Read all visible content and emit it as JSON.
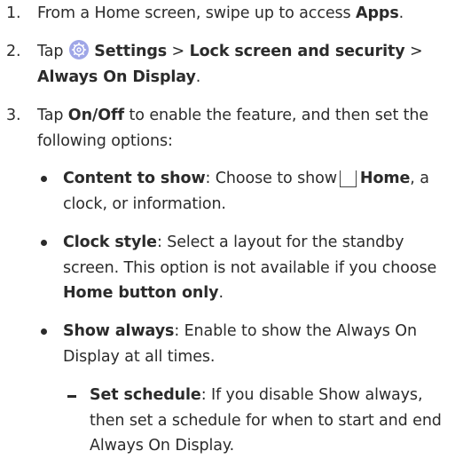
{
  "steps": [
    {
      "num": "1.",
      "prefix": "From a Home screen, swipe up to access ",
      "apps": "Apps",
      "suffix": "."
    },
    {
      "num": "2.",
      "tap": "Tap ",
      "settings": "Settings",
      "sep1": " > ",
      "lock_screen": "Lock screen and security",
      "sep2": " >",
      "always_on": "Always On Display",
      "end": "."
    },
    {
      "num": "3.",
      "tap": "Tap ",
      "onoff": "On/Off",
      "rest": " to enable the feature, and then set the following options:"
    }
  ],
  "options": [
    {
      "label": "Content to show",
      "pre": ": Choose to show",
      "home": "Home",
      "post": ", a clock, or information."
    },
    {
      "label": "Clock style",
      "pre": ": Select a layout for the standby screen. This option is not available if you choose ",
      "home_button": "Home button only",
      "post": "."
    },
    {
      "label": "Show always",
      "pre": ": Enable to show the Always On Display at all times."
    }
  ],
  "suboption": {
    "label": "Set schedule",
    "pre": ": If you disable Show always, then set a schedule for when to start and end Always On Display."
  },
  "icons": {
    "settings": "settings-gear-icon",
    "home": "home-button-icon"
  },
  "colors": {
    "text": "#2b2b2b",
    "settings_icon_bg": "#9fa6e7"
  }
}
